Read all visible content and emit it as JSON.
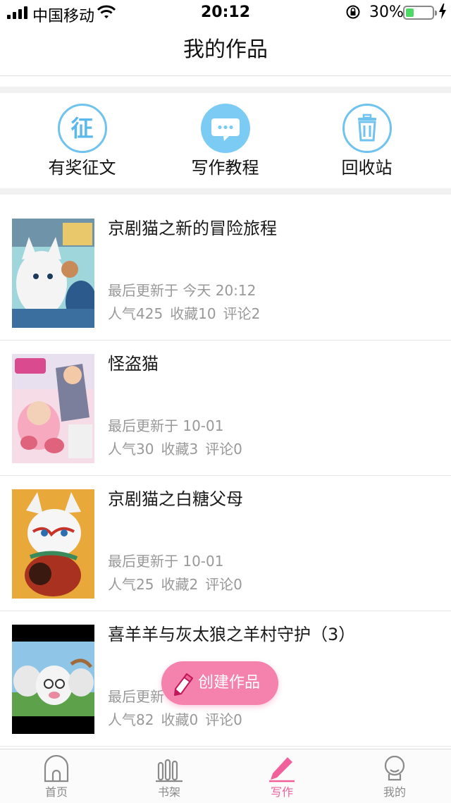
{
  "status_bar": {
    "carrier": "中国移动",
    "time": "20:12",
    "battery_percent": "30%",
    "battery_level": 0.3
  },
  "header": {
    "title": "我的作品"
  },
  "quick_actions": [
    {
      "label": "有奖征文",
      "icon": "contest-icon",
      "glyph": "征"
    },
    {
      "label": "写作教程",
      "icon": "chat-bubble-icon"
    },
    {
      "label": "回收站",
      "icon": "trash-icon"
    }
  ],
  "works": [
    {
      "title": "京剧猫之新的冒险旅程",
      "updated": "最后更新于 今天 20:12",
      "stats": [
        "人气425",
        "收藏10",
        "评论2"
      ]
    },
    {
      "title": "怪盗猫",
      "updated": "最后更新于 10-01",
      "stats": [
        "人气30",
        "收藏3",
        "评论0"
      ]
    },
    {
      "title": "京剧猫之白糖父母",
      "updated": "最后更新于 10-01",
      "stats": [
        "人气25",
        "收藏2",
        "评论0"
      ]
    },
    {
      "title": "喜羊羊与灰太狼之羊村守护（3）",
      "updated": "最后更新",
      "stats": [
        "人气82",
        "收藏0",
        "评论0"
      ]
    }
  ],
  "fab": {
    "label": "创建作品",
    "icon": "pencil-icon"
  },
  "tabbar": {
    "items": [
      {
        "label": "首页",
        "icon": "home-icon",
        "active": false
      },
      {
        "label": "书架",
        "icon": "bookshelf-icon",
        "active": false
      },
      {
        "label": "写作",
        "icon": "pen-icon",
        "active": true
      },
      {
        "label": "我的",
        "icon": "profile-icon",
        "active": false
      }
    ]
  },
  "colors": {
    "accent_pink": "#f582ad",
    "active_tab": "#f0609b",
    "icon_blue": "#6fc3ee",
    "muted_text": "#999999",
    "battery_green": "#4cd964"
  }
}
